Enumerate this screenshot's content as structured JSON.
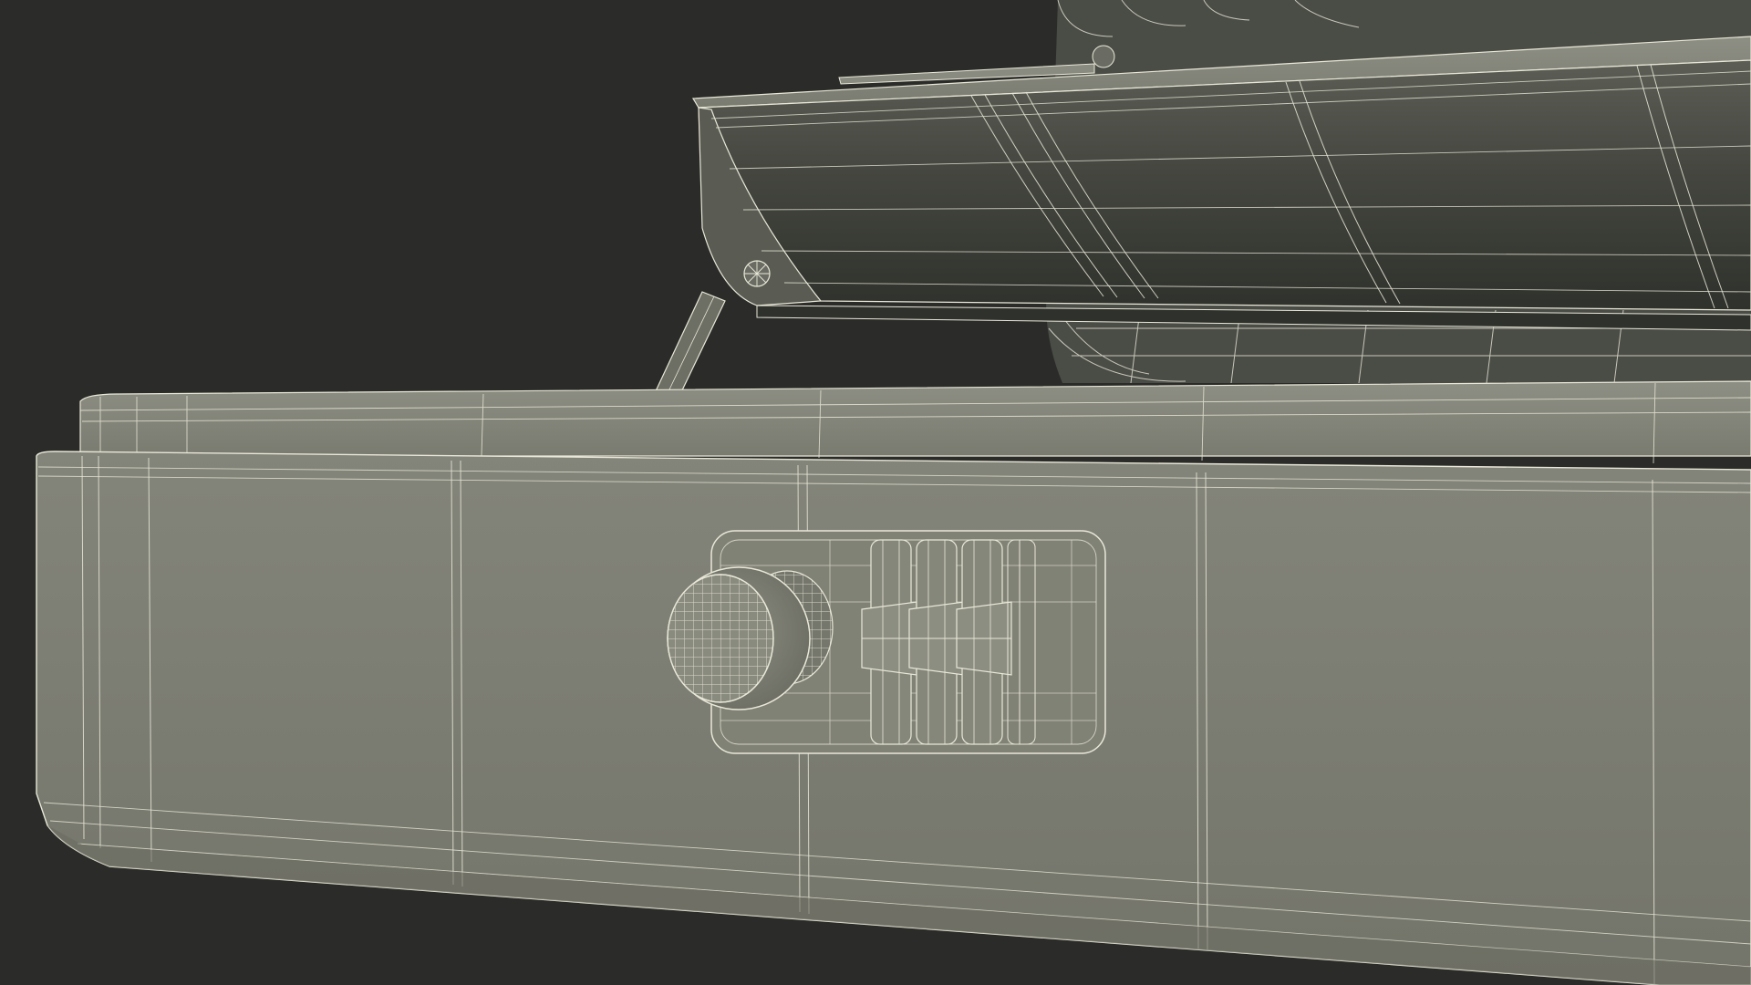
{
  "scene": {
    "subject": "wireframe-render",
    "colors": {
      "background": "#2b2b2a",
      "case_face": "#7b7c71",
      "case_face_shade": "#6d6e64",
      "case_top": "#828377",
      "lid_inner_dark": "#3c3e39",
      "lid_inner_mid": "#55574f",
      "lid_rim": "#8a8b80",
      "wire": "#e9e8d8",
      "lock_plate": "#818276",
      "lock_dial": "#86877b"
    },
    "icons": [
      "combination-lock-icon",
      "hinge-screw-icon",
      "knob-icon"
    ]
  }
}
